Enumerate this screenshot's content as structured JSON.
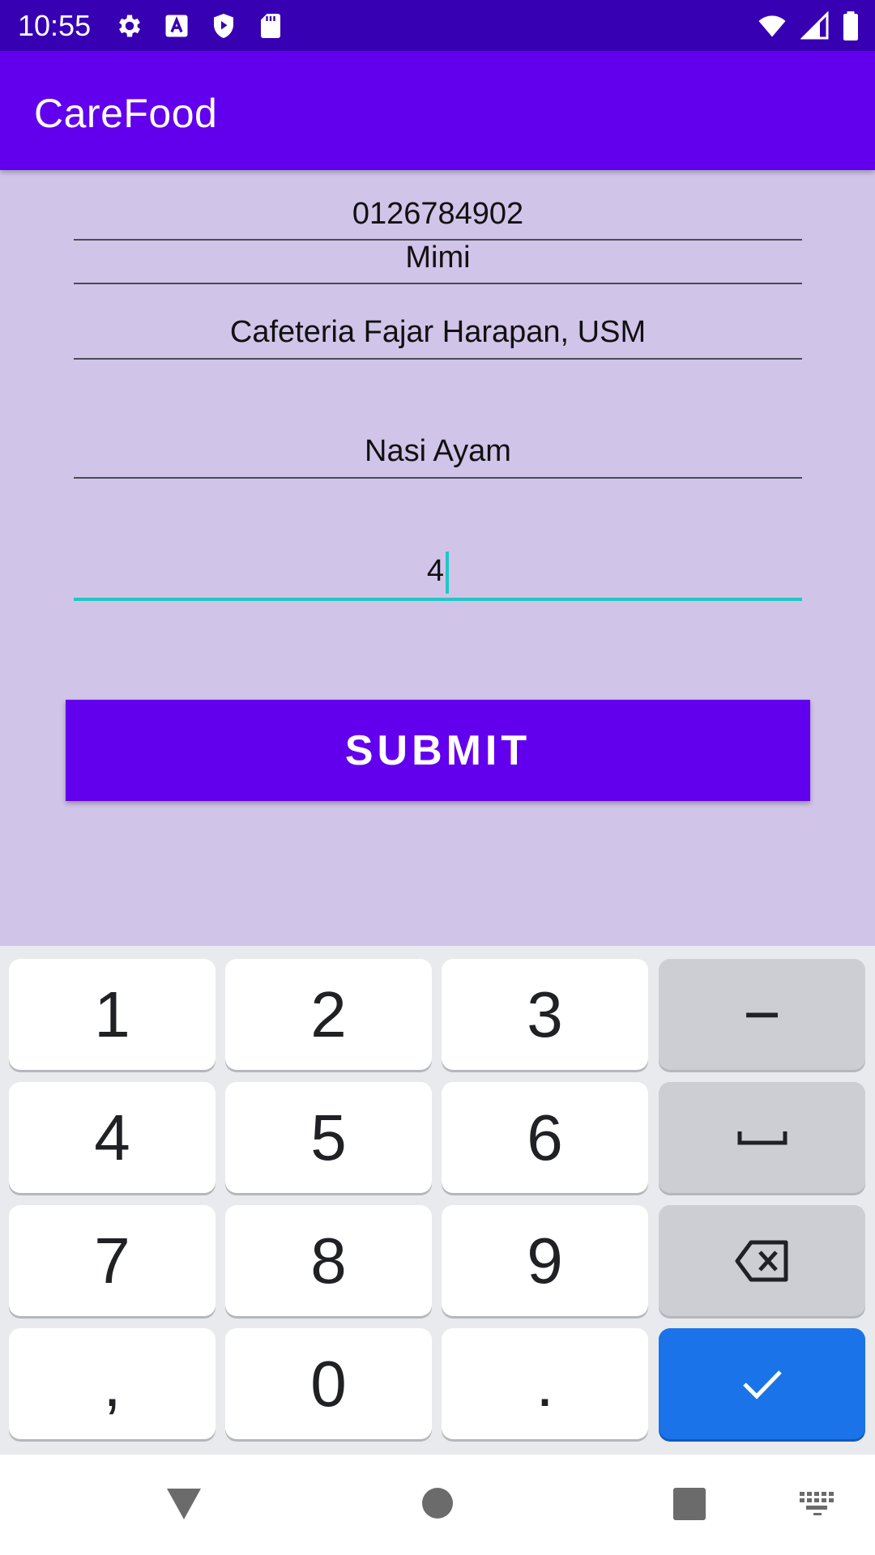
{
  "status_bar": {
    "time": "10:55",
    "icons_left": [
      "settings-icon",
      "a-icon",
      "shield-play-icon",
      "sd-card-icon"
    ],
    "icons_right": [
      "wifi-icon",
      "signal-icon",
      "battery-icon"
    ]
  },
  "app_bar": {
    "title": "CareFood"
  },
  "form": {
    "phone": "0126784902",
    "name": "Mimi",
    "location": "Cafeteria Fajar Harapan, USM",
    "food": "Nasi Ayam",
    "quantity": "4",
    "submit_label": "SUBMIT"
  },
  "keyboard": {
    "k1": "1",
    "k2": "2",
    "k3": "3",
    "minus": "−",
    "k4": "4",
    "k5": "5",
    "k6": "6",
    "k7": "7",
    "k8": "8",
    "k9": "9",
    "comma": ",",
    "k0": "0",
    "period": "."
  },
  "colors": {
    "primary": "#6200ee",
    "primary_dark": "#3700b3",
    "background": "#d1c4e9",
    "accent": "#1fc8c2",
    "enter_key": "#1a73e8"
  }
}
